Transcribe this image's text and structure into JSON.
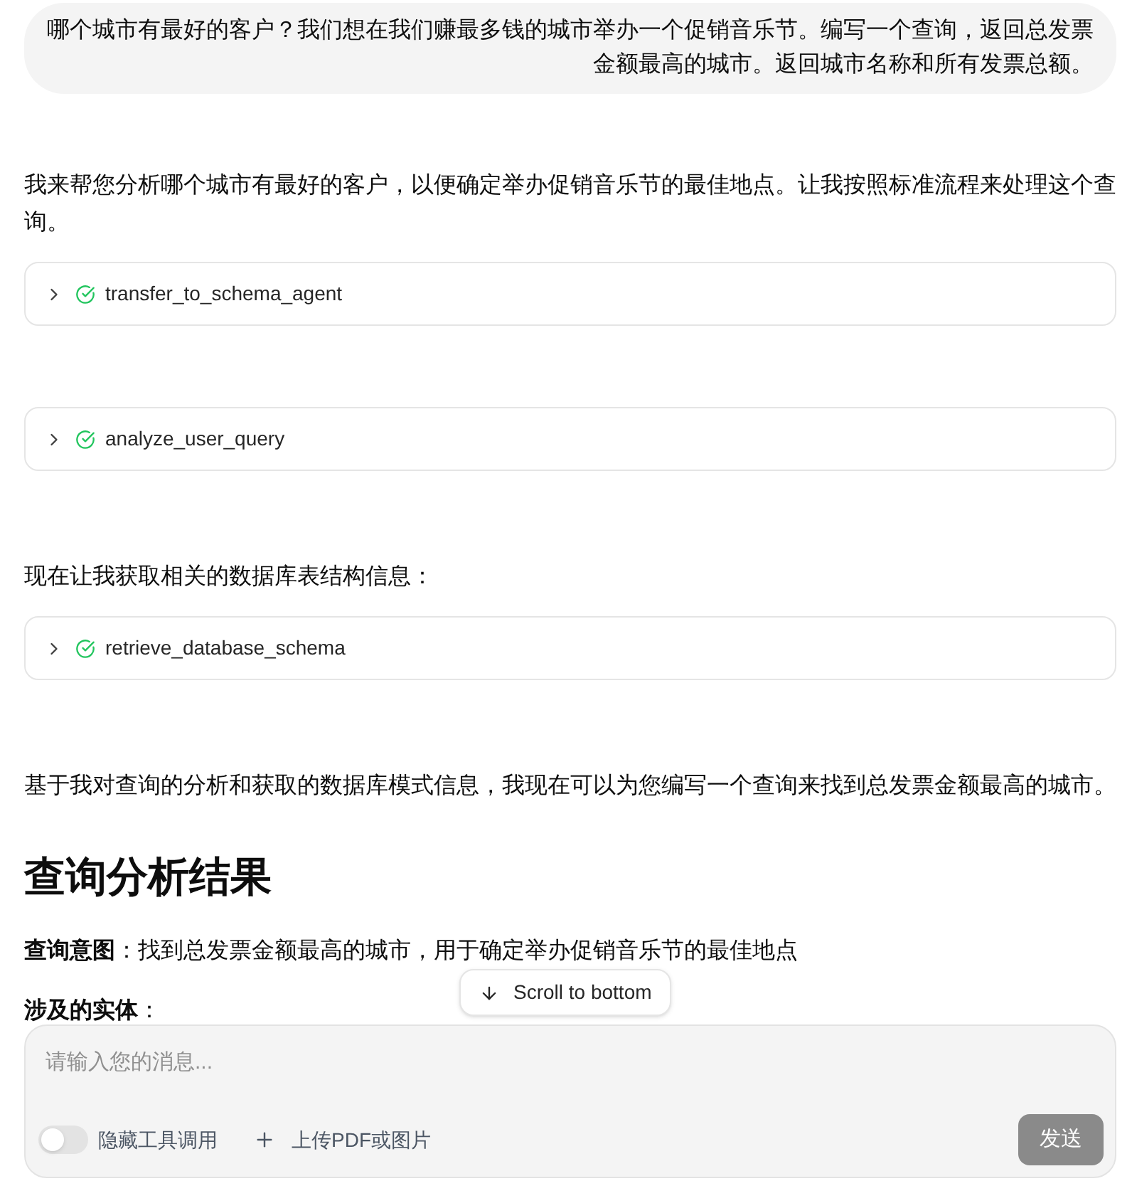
{
  "user_message": {
    "text": "哪个城市有最好的客户？我们想在我们赚最多钱的城市举办一个促销音乐节。编写一个查询，返回总发票金额最高的城市。返回城市名称和所有发票总额。"
  },
  "messages": [
    {
      "kind": "paragraph",
      "text": "我来帮您分析哪个城市有最好的客户，以便确定举办促销音乐节的最佳地点。让我按照标准流程来处理这个查询。"
    },
    {
      "kind": "tool_call",
      "name": "transfer_to_schema_agent",
      "completed": true,
      "expanded": false
    },
    {
      "kind": "tool_call",
      "name": "analyze_user_query",
      "completed": true,
      "expanded": false
    },
    {
      "kind": "paragraph",
      "text": "现在让我获取相关的数据库表结构信息："
    },
    {
      "kind": "tool_call",
      "name": "retrieve_database_schema",
      "completed": true,
      "expanded": false
    },
    {
      "kind": "paragraph",
      "text": "基于我对查询的分析和获取的数据库模式信息，我现在可以为您编写一个查询来找到总发票金额最高的城市。"
    },
    {
      "kind": "heading",
      "text": "查询分析结果"
    },
    {
      "kind": "paragraph",
      "text": "**查询意图**：找到总发票金额最高的城市，用于确定举办促销音乐节的最佳地点"
    },
    {
      "kind": "paragraph",
      "text": "**涉及的实体**："
    }
  ],
  "scroll_button": {
    "label": "Scroll to bottom"
  },
  "composer": {
    "placeholder": "请输入您的消息...",
    "toggle": {
      "label": "隐藏工具调用",
      "on": false
    },
    "upload": {
      "label": "上传PDF或图片"
    },
    "send": {
      "label": "发送",
      "disabled": true
    }
  }
}
